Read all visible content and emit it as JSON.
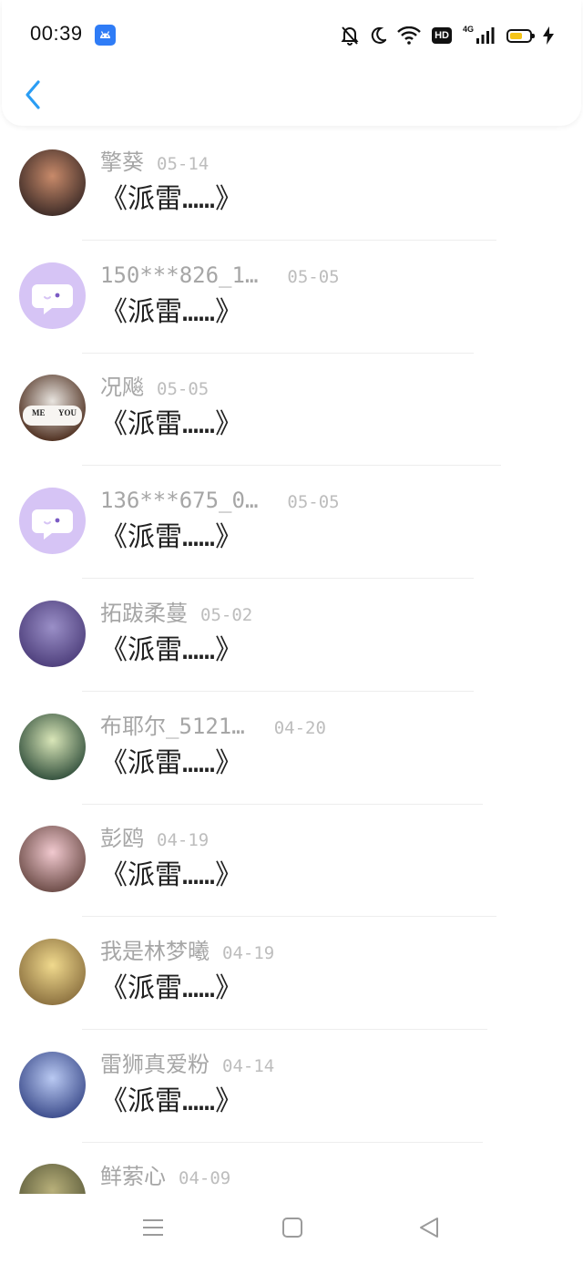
{
  "status_bar": {
    "time": "00:39",
    "network_label": "4G",
    "hd_label": "HD",
    "battery_level": 0.65,
    "icons": [
      "android-app-icon",
      "mute-bell-icon",
      "moon-icon",
      "wifi-icon",
      "hd-icon",
      "signal-icon",
      "battery-icon",
      "charging-icon"
    ]
  },
  "nav": {
    "back_icon": "chevron-left-icon",
    "accent": "#2a9df4"
  },
  "items": [
    {
      "name": "擎葵",
      "date": "05-14",
      "message": "《派雷……》",
      "avatar_colors": [
        "#3b2a26",
        "#c88a6a"
      ]
    },
    {
      "name": "150***826_1…",
      "date": "05-05",
      "message": "《派雷……》",
      "avatar_colors": [
        "#d6c4f5",
        "#ffffff"
      ],
      "default_avatar": true
    },
    {
      "name": "况飚",
      "date": "05-05",
      "message": "《派雷……》",
      "avatar_colors": [
        "#4a2a1a",
        "#e8e4df"
      ],
      "mug_text_left": "ME",
      "mug_text_right": "YOU"
    },
    {
      "name": "136***675_0…",
      "date": "05-05",
      "message": "《派雷……》",
      "avatar_colors": [
        "#d6c4f5",
        "#ffffff"
      ],
      "default_avatar": true
    },
    {
      "name": "拓跋柔蔓",
      "date": "05-02",
      "message": "《派雷……》",
      "avatar_colors": [
        "#4c3d7a",
        "#9a8fc7"
      ]
    },
    {
      "name": "布耶尔_5121…",
      "date": "04-20",
      "message": "《派雷……》",
      "avatar_colors": [
        "#2f4d3a",
        "#d9e6b8"
      ]
    },
    {
      "name": "彭鸥",
      "date": "04-19",
      "message": "《派雷……》",
      "avatar_colors": [
        "#6a4a45",
        "#f1c9cf"
      ]
    },
    {
      "name": "我是林梦曦",
      "date": "04-19",
      "message": "《派雷……》",
      "avatar_colors": [
        "#8a6f3e",
        "#f0d98d"
      ]
    },
    {
      "name": "雷狮真爱粉",
      "date": "04-14",
      "message": "《派雷……》",
      "avatar_colors": [
        "#3a4a8a",
        "#b9c9f2"
      ]
    },
    {
      "name": "鲜萦心",
      "date": "04-09",
      "message": "",
      "avatar_colors": [
        "#5a5a3a",
        "#b8b07a"
      ]
    }
  ],
  "navbar": {
    "icons": [
      "menu-icon",
      "home-square-icon",
      "back-triangle-icon"
    ]
  }
}
